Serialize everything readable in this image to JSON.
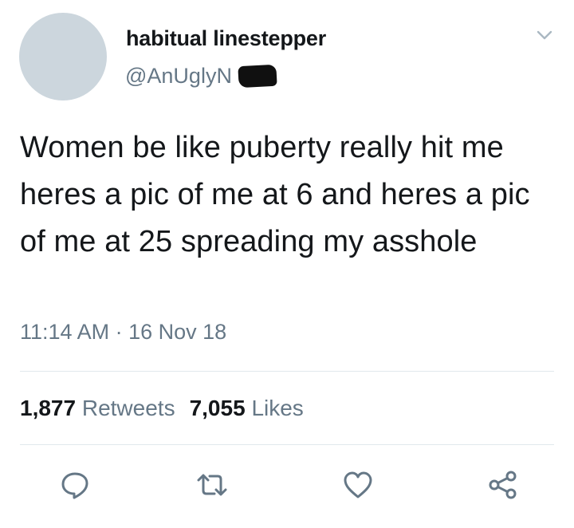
{
  "user": {
    "display_name": "habitual linestepper",
    "handle": "@AnUglyN    a"
  },
  "tweet": {
    "text": "Women be like puberty really hit me heres a pic of me at 6 and heres a pic of me at 25 spreading my asshole",
    "timestamp": "11:14 AM · 16 Nov 18"
  },
  "stats": {
    "retweets_count": "1,877",
    "retweets_label": "Retweets",
    "likes_count": "7,055",
    "likes_label": "Likes"
  },
  "icons": {
    "reply": "reply-icon",
    "retweet": "retweet-icon",
    "like": "heart-icon",
    "share": "share-icon",
    "menu": "chevron-down-icon"
  },
  "colors": {
    "primary_text": "#14171a",
    "secondary_text": "#657786",
    "avatar_placeholder": "#ccd6dd",
    "divider": "#e1e8ed"
  }
}
